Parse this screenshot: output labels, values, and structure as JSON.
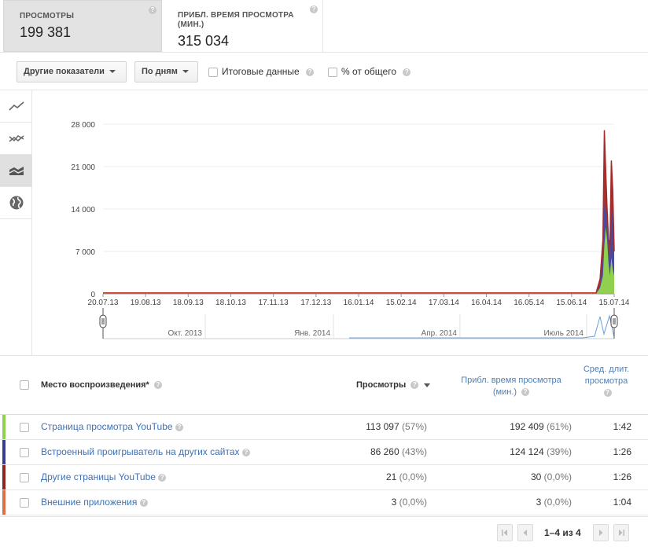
{
  "metrics": [
    {
      "label": "ПРОСМОТРЫ",
      "value": "199 381"
    },
    {
      "label": "ПРИБЛ. ВРЕМЯ ПРОСМОТРА (МИН.)",
      "value": "315 034"
    }
  ],
  "toolbar": {
    "metrics_dropdown": "Другие показатели",
    "period_dropdown": "По дням",
    "totals_label": "Итоговые данные",
    "percent_label": "% от общего"
  },
  "rail_icons": [
    "line-chart-icon",
    "multi-line-chart-icon",
    "stacked-area-chart-icon",
    "globe-map-icon"
  ],
  "chart_data": {
    "type": "area",
    "y_ticks": [
      "28 000",
      "21 000",
      "14 000",
      "7 000",
      "0"
    ],
    "ylim": [
      0,
      28000
    ],
    "x_ticks": [
      "20.07.13",
      "19.08.13",
      "18.09.13",
      "18.10.13",
      "17.11.13",
      "17.12.13",
      "16.01.14",
      "15.02.14",
      "17.03.14",
      "16.04.14",
      "16.05.14",
      "15.06.14",
      "15.07.14"
    ],
    "navigator_labels": [
      "Окт. 2013",
      "Янв. 2014",
      "Апр. 2014",
      "Июль 2014"
    ],
    "series": [
      {
        "name": "Страница просмотра YouTube",
        "color": "#8fd14f"
      },
      {
        "name": "Встроенный проигрыватель на других сайтах",
        "color": "#4a4a9c"
      },
      {
        "name": "Другие страницы YouTube",
        "color": "#a52a2a"
      },
      {
        "name": "Внешние приложения",
        "color": "#d9704a"
      }
    ],
    "x": [
      "2014-07-05",
      "2014-07-08",
      "2014-07-10",
      "2014-07-11",
      "2014-07-12",
      "2014-07-13",
      "2014-07-14",
      "2014-07-15",
      "2014-07-16",
      "2014-07-17",
      "2014-07-18"
    ],
    "stacked_values": {
      "green": [
        0,
        1000,
        3000,
        8000,
        11000,
        9000,
        5000,
        3000,
        6000,
        4000,
        3000
      ],
      "blue": [
        0,
        1500,
        6000,
        15000,
        14000,
        12000,
        8000,
        5000,
        15000,
        12000,
        6000
      ],
      "total": [
        0,
        2500,
        9000,
        27000,
        20000,
        14000,
        9000,
        8000,
        22000,
        17000,
        7000
      ]
    }
  },
  "table": {
    "headers": {
      "place": "Место воспроизведения*",
      "views": "Просмотры",
      "watch_time": "Прибл. время просмотра (мин.)",
      "avg_duration": "Сред. длит. просмотра"
    },
    "rows": [
      {
        "name": "Страница просмотра YouTube",
        "views": "113 097",
        "views_pct": "(57%)",
        "time": "192 409",
        "time_pct": "(61%)",
        "avg": "1:42",
        "color": "#8fd14f"
      },
      {
        "name": "Встроенный проигрыватель на других сайтах",
        "views": "86 260",
        "views_pct": "(43%)",
        "time": "124 124",
        "time_pct": "(39%)",
        "avg": "1:26",
        "color": "#3b3b8f"
      },
      {
        "name": "Другие страницы YouTube",
        "views": "21",
        "views_pct": "(0,0%)",
        "time": "30",
        "time_pct": "(0,0%)",
        "avg": "1:26",
        "color": "#8b2323"
      },
      {
        "name": "Внешние приложения",
        "views": "3",
        "views_pct": "(0,0%)",
        "time": "3",
        "time_pct": "(0,0%)",
        "avg": "1:04",
        "color": "#d9704a"
      }
    ]
  },
  "pager": {
    "text": "1–4 из 4"
  }
}
